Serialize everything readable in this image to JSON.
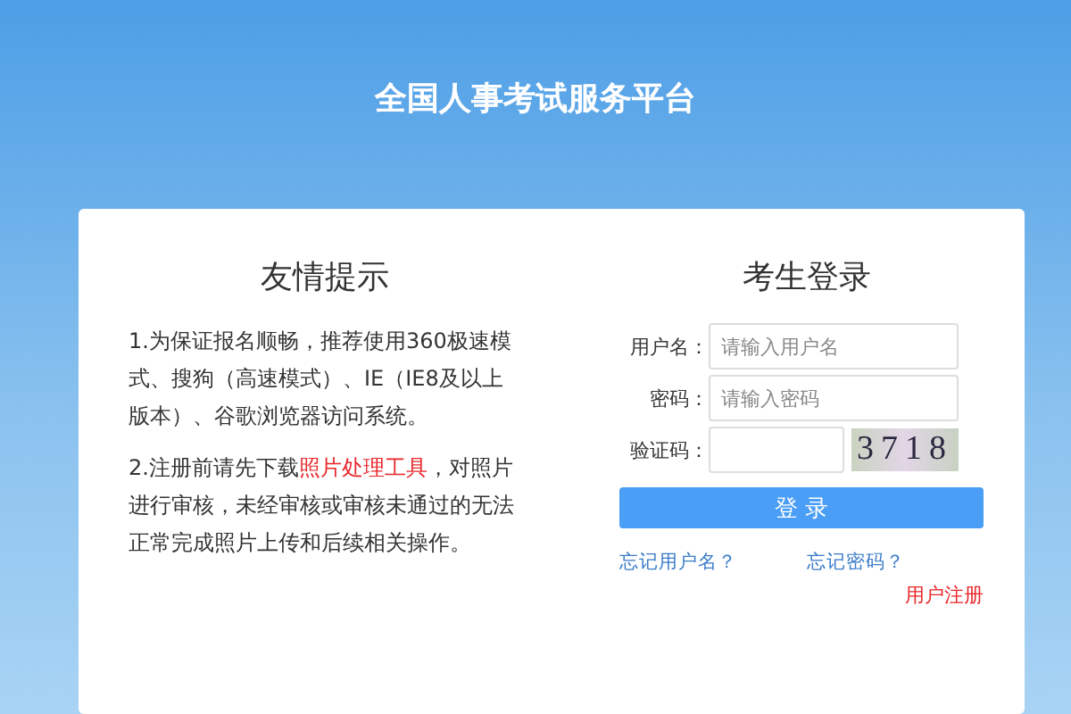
{
  "header": {
    "title": "全国人事考试服务平台"
  },
  "notice": {
    "title": "友情提示",
    "paragraphs": [
      {
        "text": "1.为保证报名顺畅，推荐使用360极速模式、搜狗（高速模式）、IE（IE8及以上版本）、谷歌浏览器访问系统。"
      },
      {
        "text": "2.注册前请先下载",
        "link": "照片处理工具",
        "after": "，对照片进行审核，未经审核或审核未通过的无法正常完成照片上传和后续相关操作。"
      }
    ]
  },
  "login": {
    "title": "考生登录",
    "fields": [
      {
        "kind": "text",
        "label": "用户名：",
        "placeholder": "请输入用户名"
      },
      {
        "kind": "password",
        "label": "密码：",
        "placeholder": "请输入密码"
      },
      {
        "kind": "captcha",
        "label": "验证码：",
        "captcha_code": "3718"
      }
    ],
    "submit": "登 录",
    "forgot_username": "忘记用户名？",
    "forgot_password": "忘记密码？",
    "register": "用户注册"
  }
}
